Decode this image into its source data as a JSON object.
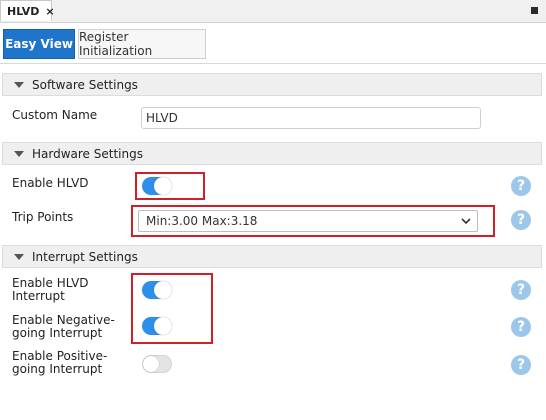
{
  "doc_tab": {
    "title": "HLVD",
    "close_glyph": "×"
  },
  "view_tabs": [
    {
      "label": "Easy View",
      "active": true
    },
    {
      "label": "Register Initialization",
      "active": false
    }
  ],
  "sections": {
    "software": {
      "title": "Software Settings"
    },
    "hardware": {
      "title": "Hardware Settings"
    },
    "interrupt": {
      "title": "Interrupt Settings"
    }
  },
  "fields": {
    "custom_name": {
      "label": "Custom Name",
      "value": "HLVD"
    },
    "enable_hlvd": {
      "label": "Enable HLVD",
      "enabled": true
    },
    "trip_points": {
      "label": "Trip Points",
      "selected": "Min:3.00 Max:3.18"
    },
    "enable_hlvd_interrupt": {
      "label_line1": "Enable HLVD",
      "label_line2": "Interrupt",
      "enabled": true
    },
    "enable_negative_interrupt": {
      "label_line1": "Enable Negative-",
      "label_line2": "going Interrupt",
      "enabled": true
    },
    "enable_positive_interrupt": {
      "label_line1": "Enable Positive-",
      "label_line2": "going Interrupt",
      "enabled": false
    }
  },
  "help_glyph": "?",
  "colors": {
    "accent": "#1f75c9",
    "toggle_on": "#2e8fea",
    "highlight": "#d11f2a",
    "help": "#9cc6ea"
  }
}
